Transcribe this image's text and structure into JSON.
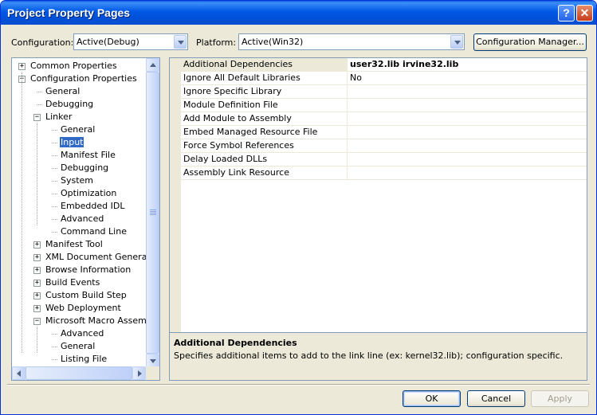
{
  "window": {
    "title": "Project Property Pages",
    "help_glyph": "?",
    "close_glyph": "✕"
  },
  "config_bar": {
    "configuration_label": "Configuration:",
    "configuration_value": "Active(Debug)",
    "platform_label": "Platform:",
    "platform_value": "Active(Win32)",
    "manager_button": "Configuration Manager..."
  },
  "tree": {
    "expander_plus": "+",
    "expander_minus": "−",
    "items": [
      {
        "label": "Common Properties",
        "expander": "plus"
      },
      {
        "label": "Configuration Properties",
        "expander": "minus"
      },
      {
        "label": "General"
      },
      {
        "label": "Debugging"
      },
      {
        "label": "Linker",
        "expander": "minus"
      },
      {
        "label": "General"
      },
      {
        "label": "Input",
        "selected": true
      },
      {
        "label": "Manifest File"
      },
      {
        "label": "Debugging"
      },
      {
        "label": "System"
      },
      {
        "label": "Optimization"
      },
      {
        "label": "Embedded IDL"
      },
      {
        "label": "Advanced"
      },
      {
        "label": "Command Line"
      },
      {
        "label": "Manifest Tool",
        "expander": "plus"
      },
      {
        "label": "XML Document Generator",
        "expander": "plus"
      },
      {
        "label": "Browse Information",
        "expander": "plus"
      },
      {
        "label": "Build Events",
        "expander": "plus"
      },
      {
        "label": "Custom Build Step",
        "expander": "plus"
      },
      {
        "label": "Web Deployment",
        "expander": "plus"
      },
      {
        "label": "Microsoft Macro Assembler",
        "expander": "minus"
      },
      {
        "label": "Advanced"
      },
      {
        "label": "General"
      },
      {
        "label": "Listing File"
      }
    ]
  },
  "properties": {
    "rows": [
      {
        "name": "Additional Dependencies",
        "value": "user32.lib irvine32.lib",
        "bold": true,
        "selected": true
      },
      {
        "name": "Ignore All Default Libraries",
        "value": "No"
      },
      {
        "name": "Ignore Specific Library",
        "value": ""
      },
      {
        "name": "Module Definition File",
        "value": ""
      },
      {
        "name": "Add Module to Assembly",
        "value": ""
      },
      {
        "name": "Embed Managed Resource File",
        "value": ""
      },
      {
        "name": "Force Symbol References",
        "value": ""
      },
      {
        "name": "Delay Loaded DLLs",
        "value": ""
      },
      {
        "name": "Assembly Link Resource",
        "value": ""
      }
    ]
  },
  "description": {
    "title": "Additional Dependencies",
    "text": "Specifies additional items to add to the link line (ex: kernel32.lib); configuration specific."
  },
  "buttons": {
    "ok": "OK",
    "cancel": "Cancel",
    "apply": "Apply"
  },
  "colors": {
    "title_bar": "#0058e6",
    "selection": "#316ac5",
    "dialog_face": "#ece9d8"
  }
}
